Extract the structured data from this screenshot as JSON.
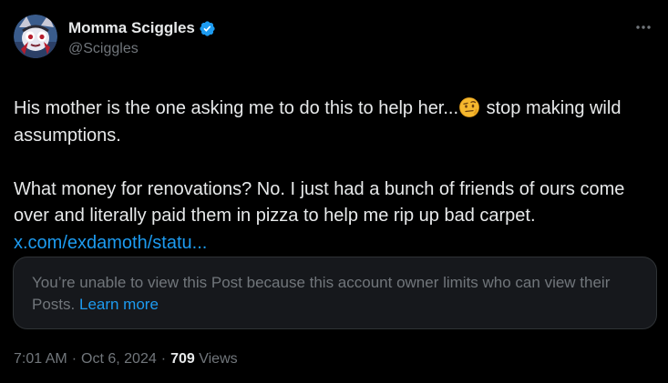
{
  "author": {
    "display_name": "Momma Sciggles",
    "handle": "@Sciggles",
    "verified": true,
    "verified_color": "#1d9bf0"
  },
  "post": {
    "line1_before_emoji": "His mother is the one asking me to do this to help her...",
    "emoji": "face-with-raised-eyebrow",
    "line1_after_emoji": " stop making wild assumptions.",
    "paragraph2": "What money for renovations? No. I just had a bunch of friends of ours come over and literally paid them in pizza to help me rip up bad carpet.",
    "link_text": "x.com/exdamoth/statu..."
  },
  "quoted_notice": {
    "text": "You’re unable to view this Post because this account owner limits who can view their Posts.",
    "learn_more": "Learn more"
  },
  "meta": {
    "time": "7:01 AM",
    "date": "Oct 6, 2024",
    "views_count": "709",
    "views_label": "Views",
    "separator": "·"
  },
  "colors": {
    "background": "#000000",
    "text": "#e7e9ea",
    "secondary": "#71767b",
    "link": "#1d9bf0",
    "card_border": "#2f3336"
  },
  "icons": {
    "more": "more-horizontal-icon",
    "verified": "verified-badge-icon"
  }
}
